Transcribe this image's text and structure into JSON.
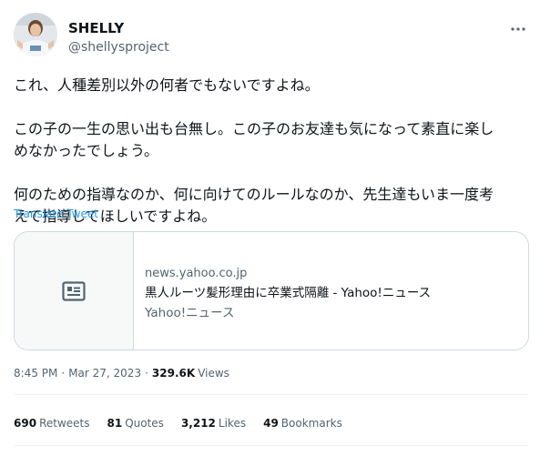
{
  "author": {
    "display_name": "SHELLY",
    "handle": "@shellysproject"
  },
  "tweet": {
    "paragraphs": [
      "これ、人種差別以外の何者でもないですよね。",
      "この子の一生の思い出も台無し。この子のお友達も気になって素直に楽し\nめなかったでしょう。",
      "何のための指導なのか、何に向けてのルールなのか、先生達もいま一度考\nえて指導してほしいですよね。"
    ],
    "translate_label": "Translate Tweet"
  },
  "card": {
    "icon": "news-article-icon",
    "domain": "news.yahoo.co.jp",
    "title": "黒人ルーツ髪形理由に卒業式隔離 - Yahoo!ニュース",
    "description": "Yahoo!ニュース"
  },
  "meta": {
    "time": "8:45 PM",
    "separator": "·",
    "date": "Mar 27, 2023",
    "views_count": "329.6K",
    "views_label": "Views"
  },
  "stats": {
    "retweets": {
      "count": "690",
      "label": "Retweets"
    },
    "quotes": {
      "count": "81",
      "label": "Quotes"
    },
    "likes": {
      "count": "3,212",
      "label": "Likes"
    },
    "bookmarks": {
      "count": "49",
      "label": "Bookmarks"
    }
  },
  "colors": {
    "accent": "#1d9bf0",
    "secondary_text": "#536471",
    "primary_text": "#0f1419",
    "border": "#cfd9de"
  }
}
